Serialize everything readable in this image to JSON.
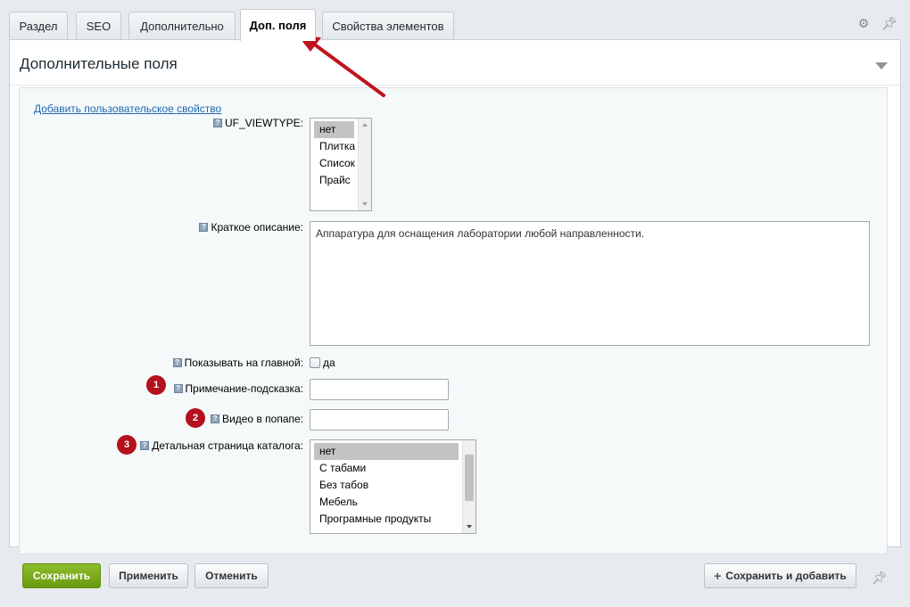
{
  "tabs": [
    {
      "label": "Раздел"
    },
    {
      "label": "SEO"
    },
    {
      "label": "Дополнительно"
    },
    {
      "label": "Доп. поля"
    },
    {
      "label": "Свойства элементов"
    }
  ],
  "panel": {
    "title": "Дополнительные поля",
    "add_link": "Добавить пользовательское свойство"
  },
  "help_glyph": "?",
  "fields": {
    "viewtype": {
      "label": "UF_VIEWTYPE:",
      "options": [
        "нет",
        "Плитка",
        "Список",
        "Прайс"
      ],
      "selected": "нет"
    },
    "short_desc": {
      "label": "Краткое описание:",
      "value": "Аппаратура для оснащения лаборатории любой направленности."
    },
    "show_main": {
      "label": "Показывать на главной:",
      "checkbox_label": "да",
      "checked": false
    },
    "hint": {
      "label": "Примечание-подсказка:",
      "value": "",
      "badge": "1"
    },
    "video": {
      "label": "Видео в попапе:",
      "value": "",
      "badge": "2"
    },
    "detail_page": {
      "label": "Детальная страница каталога:",
      "options": [
        "нет",
        "С табами",
        "Без табов",
        "Мебель",
        "Програмные продукты"
      ],
      "selected": "нет",
      "badge": "3"
    }
  },
  "footer": {
    "save": "Сохранить",
    "apply": "Применить",
    "cancel": "Отменить",
    "save_add": "Сохранить и добавить"
  },
  "colors": {
    "accent_green": "#76a319",
    "annotation_red": "#b4111d",
    "link_blue": "#2067b0"
  }
}
